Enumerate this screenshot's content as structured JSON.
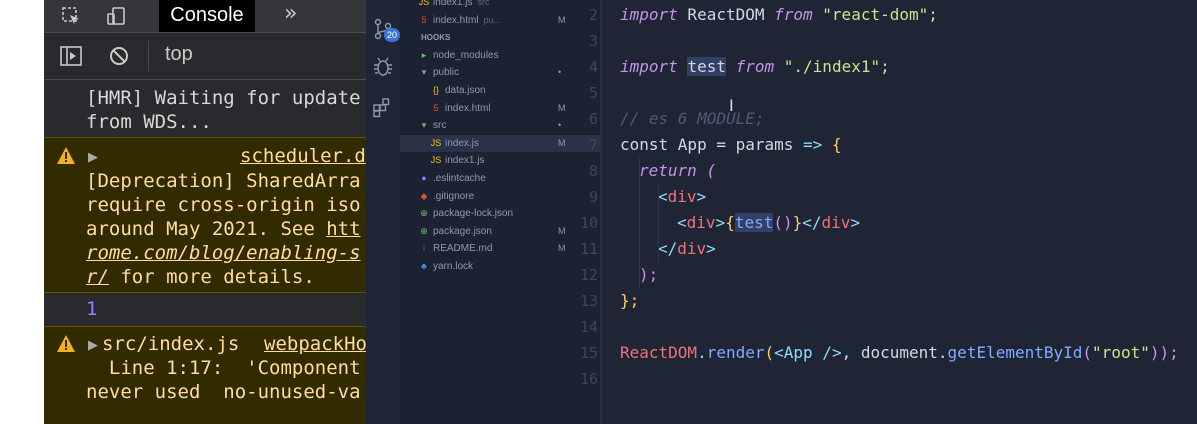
{
  "devtools": {
    "tab_active": "Console",
    "more_tabs": "»",
    "context": "top",
    "messages": {
      "hmr": [
        "[HMR] Waiting for update",
        "from WDS..."
      ],
      "warn1": {
        "source_link": "scheduler.d",
        "lines": [
          "[Deprecation] SharedArra",
          "require cross-origin iso",
          "around May 2021. See ",
          "rome.com/blog/enabling-s",
          " for more details."
        ],
        "link_tail_1": "htt",
        "link_tail_2": "r/"
      },
      "result": "1",
      "warn2": {
        "file": "src/index.js",
        "source_link": "webpackHo",
        "lines": [
          "  Line 1:17:  'Component",
          "never used  no-unused-va"
        ]
      }
    }
  },
  "vscode": {
    "activity": {
      "badge": "20"
    },
    "explorer": {
      "items": [
        {
          "label": "index1.js",
          "suffix": "src",
          "status": "",
          "glyph": "JS",
          "color": "#f1c40f",
          "indent": 1
        },
        {
          "label": "index.html",
          "suffix": "pu...",
          "status": "M",
          "glyph": "5",
          "color": "#e44d26",
          "indent": 1
        },
        {
          "label": "HOOKS",
          "suffix": "",
          "status": "",
          "glyph": "",
          "color": "#8e9ab2",
          "indent": 0
        },
        {
          "label": "node_modules",
          "suffix": "",
          "status": "",
          "glyph": "▸",
          "color": "#6fbf73",
          "indent": 1
        },
        {
          "label": "public",
          "suffix": "",
          "status": "•",
          "glyph": "▾",
          "color": "#6fa8dc",
          "indent": 1
        },
        {
          "label": "data.json",
          "suffix": "",
          "status": "",
          "glyph": "{}",
          "color": "#f1c40f",
          "indent": 2
        },
        {
          "label": "index.html",
          "suffix": "",
          "status": "M",
          "glyph": "5",
          "color": "#e44d26",
          "indent": 2
        },
        {
          "label": "src",
          "suffix": "",
          "status": "•",
          "glyph": "▾",
          "color": "#6fbf73",
          "indent": 1
        },
        {
          "label": "index.js",
          "suffix": "",
          "status": "M",
          "glyph": "JS",
          "color": "#f1c40f",
          "indent": 2
        },
        {
          "label": "index1.js",
          "suffix": "",
          "status": "",
          "glyph": "JS",
          "color": "#f1c40f",
          "indent": 2
        },
        {
          "label": ".eslintcache",
          "suffix": "",
          "status": "",
          "glyph": "●",
          "color": "#7b7bff",
          "indent": 1
        },
        {
          "label": ".gitignore",
          "suffix": "",
          "status": "",
          "glyph": "◆",
          "color": "#e44d26",
          "indent": 1
        },
        {
          "label": "package-lock.json",
          "suffix": "",
          "status": "",
          "glyph": "⊕",
          "color": "#6fbf73",
          "indent": 1
        },
        {
          "label": "package.json",
          "suffix": "",
          "status": "M",
          "glyph": "⊕",
          "color": "#6fbf73",
          "indent": 1
        },
        {
          "label": "README.md",
          "suffix": "",
          "status": "M",
          "glyph": "i",
          "color": "#3a76d8",
          "indent": 1
        },
        {
          "label": "yarn.lock",
          "suffix": "",
          "status": "",
          "glyph": "♣",
          "color": "#4a90e2",
          "indent": 1
        }
      ]
    },
    "editor": {
      "line_numbers": [
        "2",
        "3",
        "4",
        "5",
        "6",
        "7",
        "8",
        "9",
        "10",
        "11",
        "12",
        "13",
        "14",
        "15",
        "16"
      ],
      "l2": {
        "kw": "import",
        "id": " ReactDOM ",
        "from": "from",
        "str": " \"react-dom\";"
      },
      "l4": {
        "kw": "import",
        "sp": " ",
        "id": "test",
        "from": " from",
        "str": " \"./index1\";"
      },
      "l6": "// es 6 MODULE;",
      "l7": {
        "a": "const App = params ",
        "arrow": "=>",
        "brace": " {"
      },
      "l8": {
        "kw": "return",
        "paren": " ("
      },
      "l9": {
        "open": "<",
        "tag": "div",
        "close": ">"
      },
      "l10": {
        "open": "<",
        "tag": "div",
        "close": ">",
        "b1": "{",
        "call": "test",
        "par": "()",
        "b2": "}",
        "open2": "</",
        "tag2": "div",
        "close2": ">"
      },
      "l11": {
        "open": "</",
        "tag": "div",
        "close": ">"
      },
      "l12": ");",
      "l13": "};",
      "l15": {
        "obj": "ReactDOM",
        "dot": ".",
        "fn": "render",
        "p1": "(",
        "jsx": "<App />",
        "rest": ", document.",
        "fn2": "getElementById",
        "p2": "(",
        "str": "\"root\"",
        "p3": "));"
      }
    }
  }
}
